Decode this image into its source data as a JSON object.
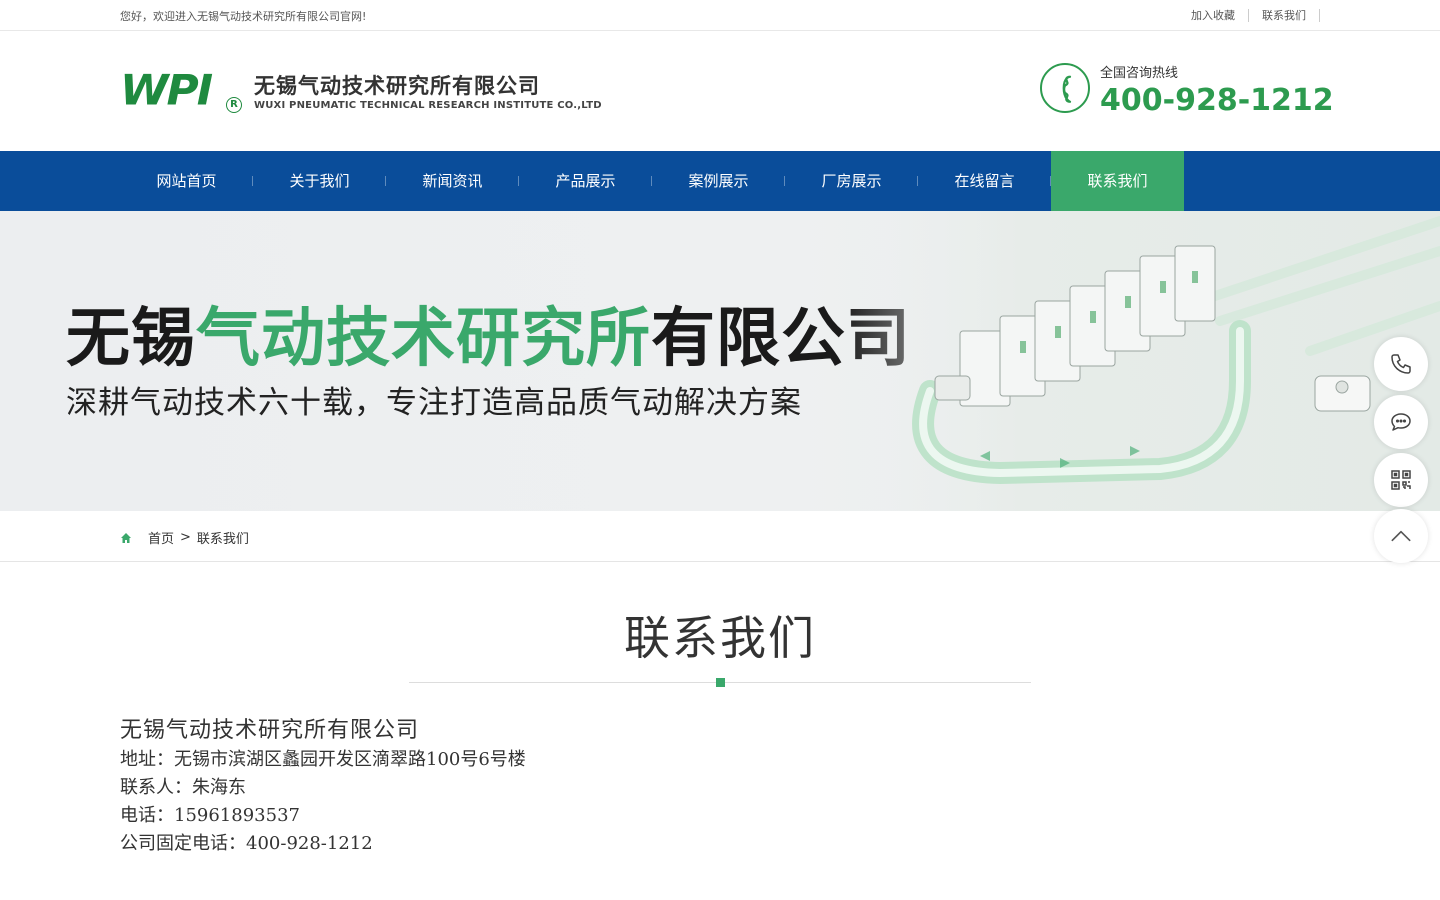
{
  "topbar": {
    "welcome": "您好，欢迎进入无锡气动技术研究所有限公司官网!",
    "links": [
      "加入收藏",
      "联系我们"
    ]
  },
  "logo": {
    "mark": "WPI",
    "reg": "R",
    "name_cn": "无锡气动技术研究所有限公司",
    "name_en": "WUXI PNEUMATIC TECHNICAL RESEARCH INSTITUTE CO.,LTD"
  },
  "hotline": {
    "label": "全国咨询热线",
    "number": "400-928-1212",
    "icon": "phone-icon"
  },
  "nav": {
    "items": [
      "网站首页",
      "关于我们",
      "新闻资讯",
      "产品展示",
      "案例展示",
      "厂房展示",
      "在线留言",
      "联系我们"
    ],
    "active_index": 7
  },
  "banner": {
    "title_part1": "无锡",
    "title_part2": "气动技术研究所",
    "title_part3": "有限公司",
    "subtitle": "深耕气动技术六十载，专注打造高品质气动解决方案"
  },
  "breadcrumb": {
    "home": "首页",
    "separator": ">",
    "current": "联系我们"
  },
  "contact": {
    "heading": "联系我们",
    "company": "无锡气动技术研究所有限公司",
    "address": "地址：无锡市滨湖区蠡园开发区滴翠路100号6号楼",
    "person": "联系人：朱海东",
    "phone": "电话：15961893537",
    "fixed_phone": "公司固定电话：400-928-1212"
  },
  "colors": {
    "brand_green": "#3aa86b",
    "nav_blue": "#0a4d9a",
    "logo_green": "#1f8a3f"
  },
  "floating_icons": [
    "phone-icon",
    "chat-icon",
    "qrcode-icon",
    "back-to-top-icon"
  ]
}
